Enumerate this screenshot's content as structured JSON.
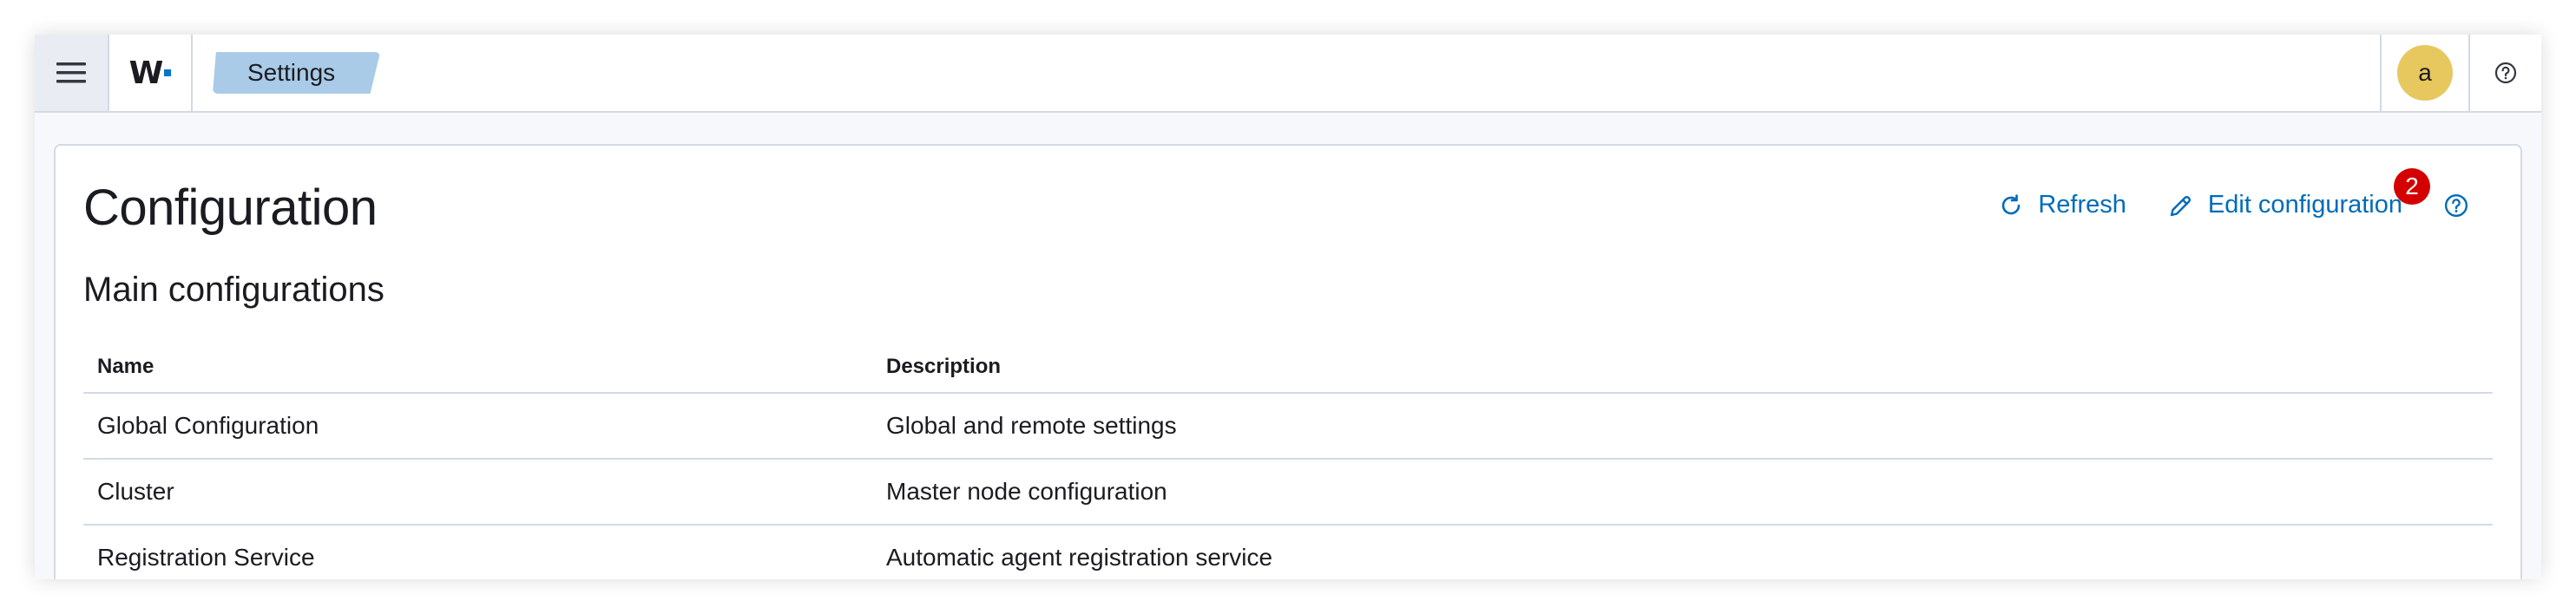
{
  "header": {
    "logo_text": "W",
    "breadcrumb": "Settings",
    "avatar_initial": "a"
  },
  "page": {
    "title": "Configuration",
    "actions": {
      "refresh_label": "Refresh",
      "edit_label": "Edit configuration",
      "edit_badge": "2"
    },
    "section_title": "Main configurations",
    "table": {
      "columns": [
        "Name",
        "Description"
      ],
      "rows": [
        {
          "name": "Global Configuration",
          "description": "Global and remote settings"
        },
        {
          "name": "Cluster",
          "description": "Master node configuration"
        },
        {
          "name": "Registration Service",
          "description": "Automatic agent registration service"
        }
      ]
    }
  },
  "colors": {
    "accent": "#006bb8",
    "breadcrumb_bg": "#a9cbe8",
    "avatar_bg": "#e7c85f",
    "badge_bg": "#d40000"
  },
  "icons": {
    "menu": "hamburger-menu-icon",
    "help": "question-circle-icon",
    "refresh": "refresh-icon",
    "edit": "pencil-icon"
  }
}
